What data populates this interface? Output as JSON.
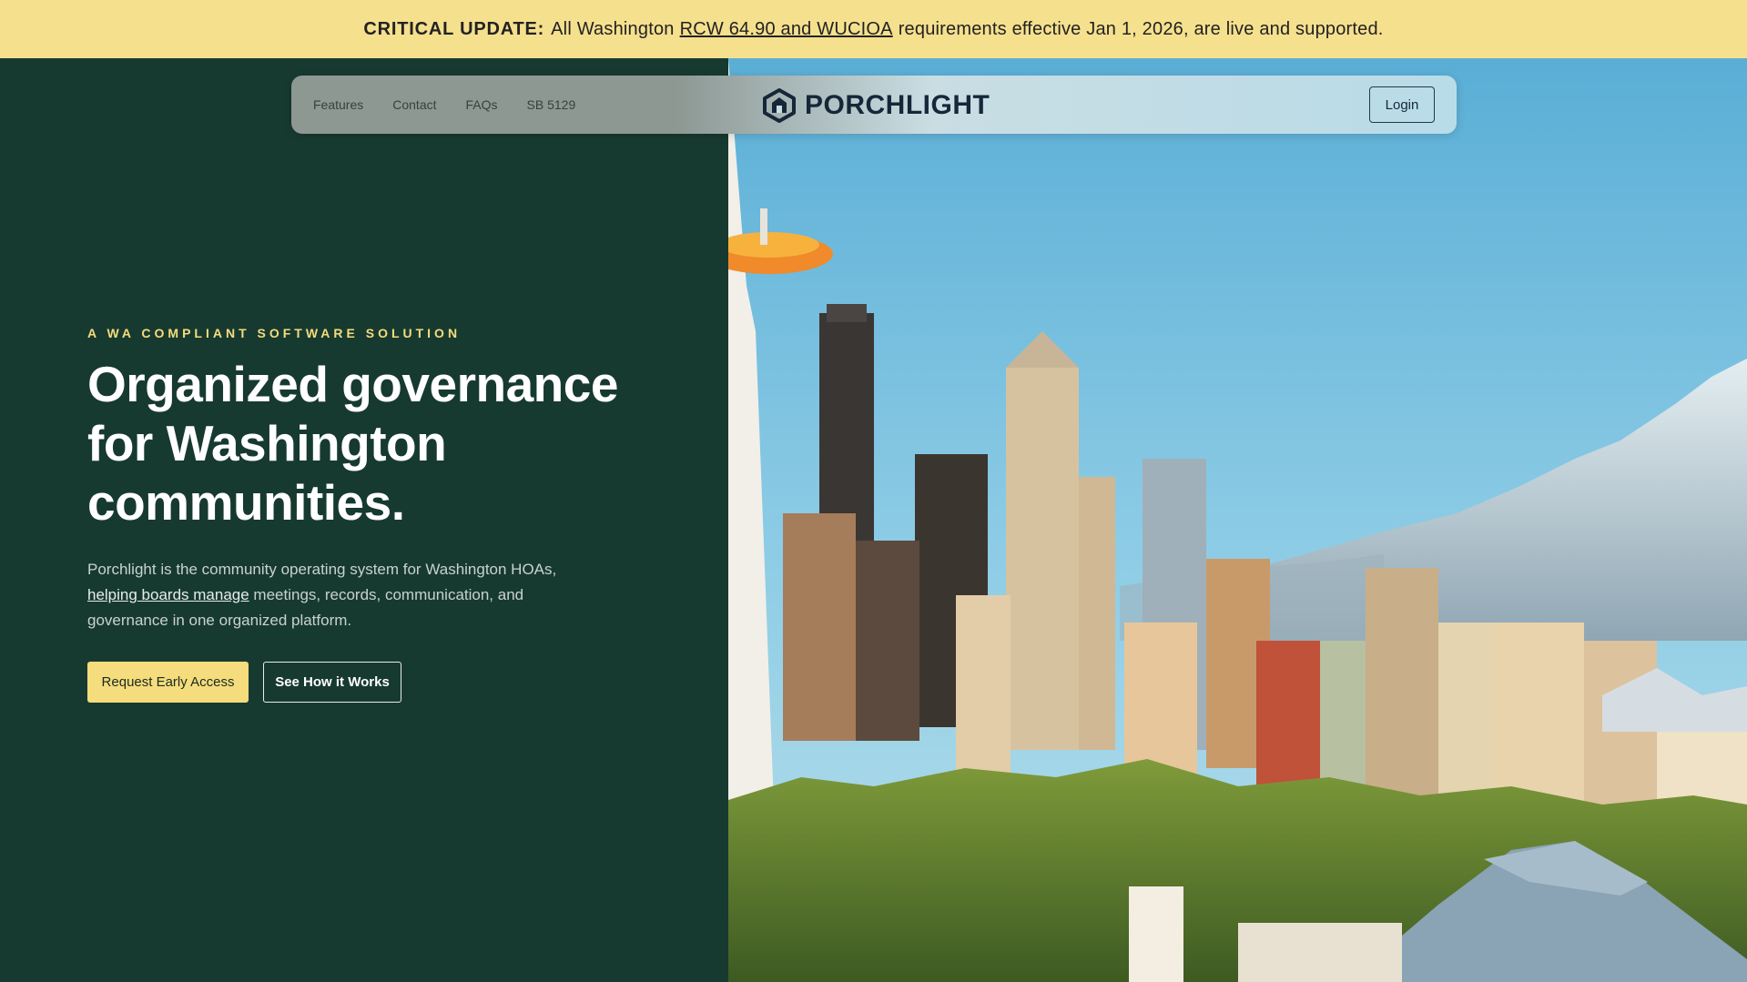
{
  "banner": {
    "label": "CRITICAL UPDATE:",
    "text_before": "All Washington",
    "link": "RCW 64.90 and WUCIOA",
    "text_after": "requirements effective Jan 1, 2026, are live and supported."
  },
  "nav": {
    "links": [
      "Features",
      "Contact",
      "FAQs",
      "SB 5129"
    ],
    "logo_text": "PORCHLIGHT",
    "login_label": "Login"
  },
  "hero": {
    "eyebrow": "A WA COMPLIANT SOFTWARE SOLUTION",
    "headline": "Organized governance for Washington communities.",
    "description_before": "Porchlight is the community operating system for Washington HOAs,",
    "description_link": "helping boards manage",
    "description_after": "meetings, records, communication, and governance in one organized platform.",
    "primary_cta": "Request Early Access",
    "secondary_cta": "See How it Works"
  },
  "icons": {
    "logo": "hexagon-house-icon"
  },
  "colors": {
    "banner_bg": "#f5e08e",
    "hero_bg": "#173a30",
    "accent_yellow": "#f5dc7c",
    "logo_navy": "#17273a"
  }
}
